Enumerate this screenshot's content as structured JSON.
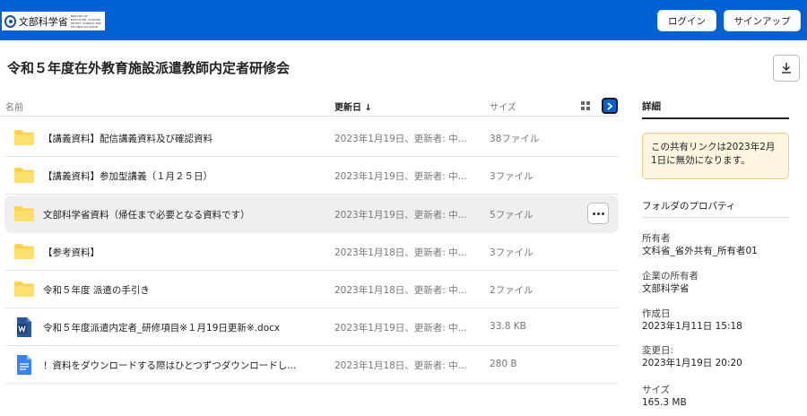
{
  "header": {
    "logo_text": "文部科学省",
    "logo_subtext": "MINISTRY OF EDUCATION, CULTURE, SPORTS, SCIENCE AND TECHNOLOGY-JAPAN",
    "login_label": "ログイン",
    "signup_label": "サインアップ"
  },
  "page": {
    "title": "令和５年度在外教育施設派遣教師内定者研修会"
  },
  "table": {
    "columns": {
      "name": "名前",
      "updated": "更新日",
      "sort_arrow": "↓",
      "size": "サイズ"
    },
    "rows": [
      {
        "type": "folder",
        "name": "【講義資料】配信講義資料及び確認資料",
        "updated": "2023年1月19日、更新者: 中...",
        "size": "38ファイル"
      },
      {
        "type": "folder",
        "name": "【講義資料】参加型講義（１月２５日）",
        "updated": "2023年1月19日、更新者: 中...",
        "size": "3ファイル"
      },
      {
        "type": "folder",
        "name": "文部科学省資料（帰任まで必要となる資料です）",
        "updated": "2023年1月19日、更新者: 中...",
        "size": "5ファイル"
      },
      {
        "type": "folder",
        "name": "【参考資料】",
        "updated": "2023年1月18日、更新者: 中...",
        "size": "3ファイル"
      },
      {
        "type": "folder",
        "name": "令和５年度 派遣の手引き",
        "updated": "2023年1月18日、更新者: 中...",
        "size": "2ファイル"
      },
      {
        "type": "docx",
        "name": "令和５年度派遣内定者_研修項目※１月19日更新※.docx",
        "updated": "2023年1月19日、更新者: 中...",
        "size": "33.8 KB"
      },
      {
        "type": "gdoc",
        "name": "！資料をダウンロードする際はひとつずつダウンロードし...",
        "updated": "2023年1月18日、更新者: 中...",
        "size": "280 B"
      }
    ]
  },
  "details": {
    "tab_label": "詳細",
    "notice": "この共有リンクは2023年2月1日に無効になります。",
    "props_title": "フォルダのプロパティ",
    "owner_label": "所有者",
    "owner_value": "文科省_省外共有_所有者01",
    "enterprise_owner_label": "企業の所有者",
    "enterprise_owner_value": "文部科学省",
    "created_label": "作成日",
    "created_value": "2023年1月11日 15:18",
    "modified_label": "変更日:",
    "modified_value": "2023年1月19日 20:20",
    "size_label": "サイズ",
    "size_value": "165.3 MB"
  },
  "colors": {
    "brand": "#0061d5",
    "folder": "#ffd34e",
    "docx": "#2b579a",
    "gdoc": "#3b82f6",
    "notice_bg": "#fff5e0"
  }
}
